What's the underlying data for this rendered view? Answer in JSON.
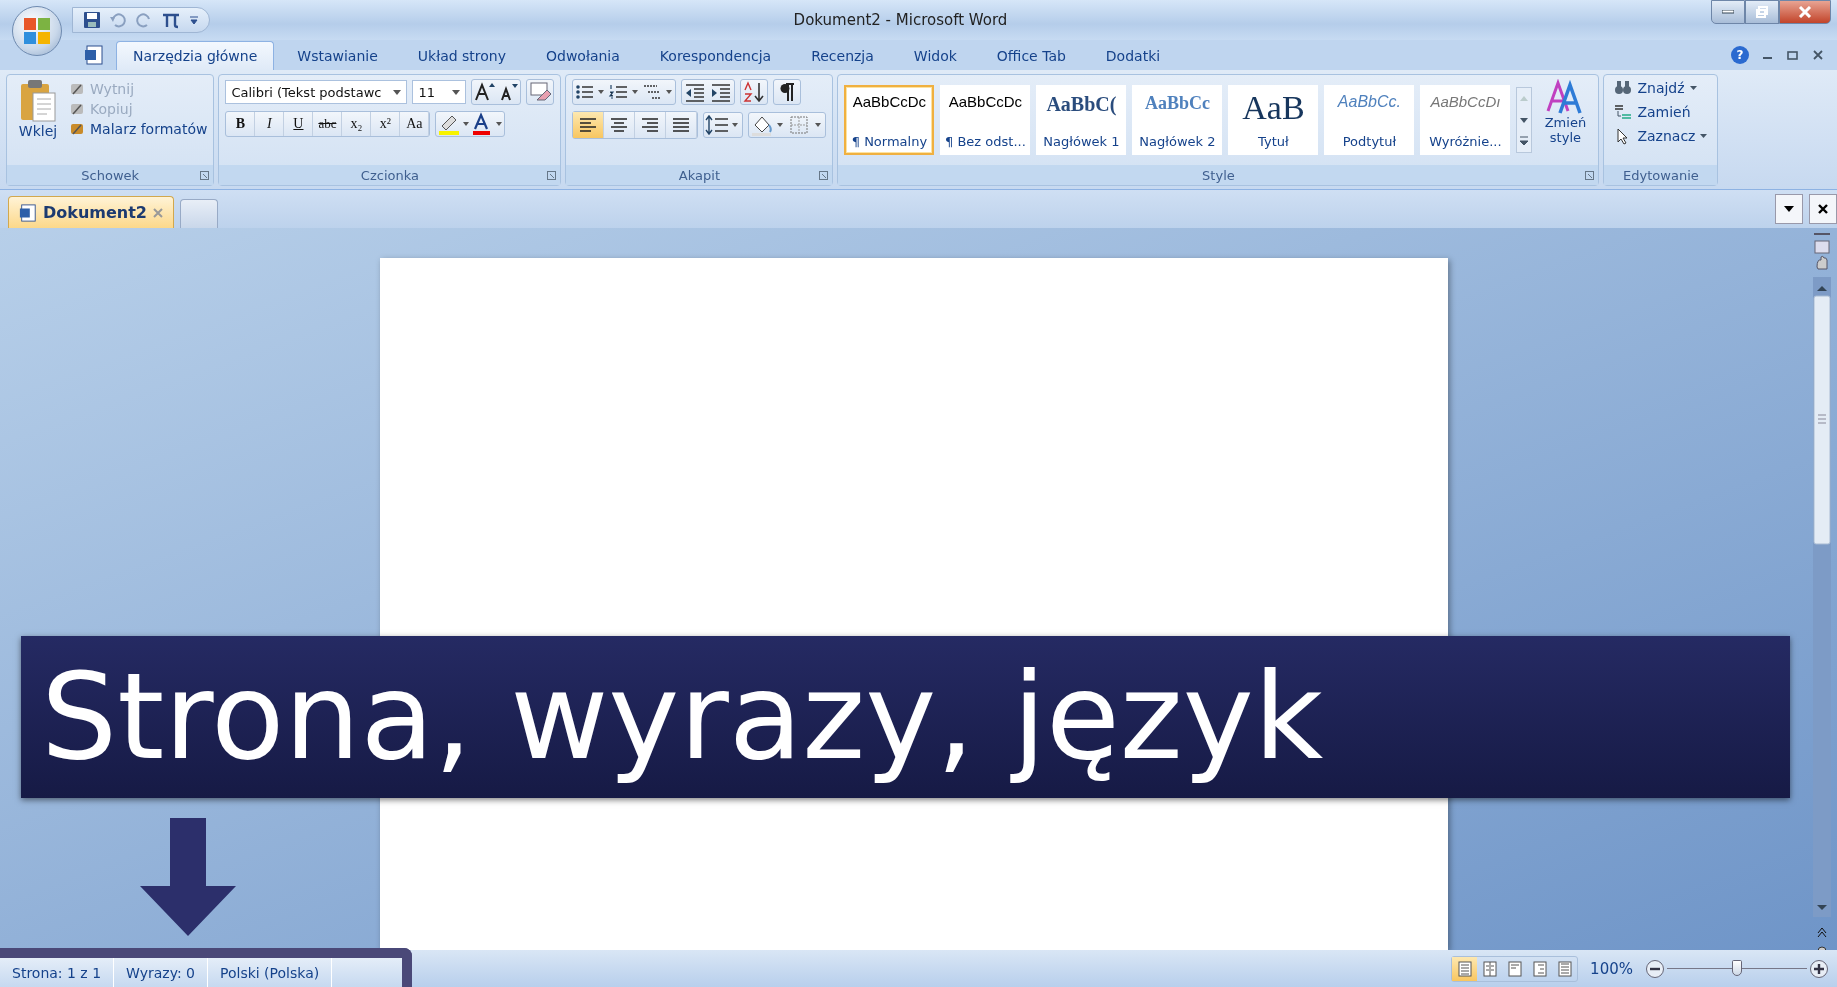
{
  "window": {
    "title": "Dokument2 - Microsoft Word"
  },
  "help": "?",
  "menu_tabs": [
    {
      "label": "Narzędzia główne",
      "selected": true
    },
    {
      "label": "Wstawianie",
      "selected": false
    },
    {
      "label": "Układ strony",
      "selected": false
    },
    {
      "label": "Odwołania",
      "selected": false
    },
    {
      "label": "Korespondencja",
      "selected": false
    },
    {
      "label": "Recenzja",
      "selected": false
    },
    {
      "label": "Widok",
      "selected": false
    },
    {
      "label": "Office Tab",
      "selected": false
    },
    {
      "label": "Dodatki",
      "selected": false
    }
  ],
  "clipboard": {
    "paste_label": "Wklej",
    "items": [
      {
        "label": "Wytnij",
        "disabled": true
      },
      {
        "label": "Kopiuj",
        "disabled": true
      },
      {
        "label": "Malarz formatów",
        "disabled": false
      }
    ],
    "group_label": "Schowek"
  },
  "font": {
    "font_name": "Calibri (Tekst podstawc",
    "font_size": "11",
    "format_buttons": [
      "B",
      "I",
      "U",
      "abc",
      "x₂",
      "x²",
      "Aa"
    ],
    "group_label": "Czcionka"
  },
  "paragraph": {
    "alignments": [
      {
        "selected": true
      },
      {
        "selected": false
      },
      {
        "selected": false
      },
      {
        "selected": false
      }
    ],
    "group_label": "Akapit"
  },
  "styles": {
    "items": [
      {
        "sample": "AaBbCcDc",
        "label": "¶ Normalny",
        "kind": "body",
        "selected": true
      },
      {
        "sample": "AaBbCcDc",
        "label": "¶ Bez odst...",
        "kind": "body",
        "selected": false
      },
      {
        "sample": "AaBbC(",
        "label": "Nagłówek 1",
        "kind": "heading1",
        "selected": false
      },
      {
        "sample": "AaBbCc",
        "label": "Nagłówek 2",
        "kind": "heading2",
        "selected": false
      },
      {
        "sample": "AaB",
        "label": "Tytuł",
        "kind": "title",
        "selected": false
      },
      {
        "sample": "AaBbCc.",
        "label": "Podtytuł",
        "kind": "subtitle",
        "selected": false
      },
      {
        "sample": "AaBbCcDı",
        "label": "Wyróżnie...",
        "kind": "emphasis",
        "selected": false
      }
    ],
    "change_label": "Zmień style",
    "group_label": "Style"
  },
  "editing": {
    "items": [
      "Znajdź",
      "Zamień",
      "Zaznacz"
    ],
    "group_label": "Edytowanie"
  },
  "document_tab": {
    "label": "Dokument2"
  },
  "banner": {
    "text": "Strona, wyrazy, język"
  },
  "status_bar": {
    "items": [
      "Strona: 1 z 1",
      "Wyrazy: 0",
      "Polski (Polska)"
    ],
    "views": [
      {
        "selected": true
      },
      {
        "selected": false
      },
      {
        "selected": false
      },
      {
        "selected": false
      },
      {
        "selected": false
      }
    ],
    "zoom": "100%",
    "zoom_slider": {
      "level": 0.5
    }
  }
}
